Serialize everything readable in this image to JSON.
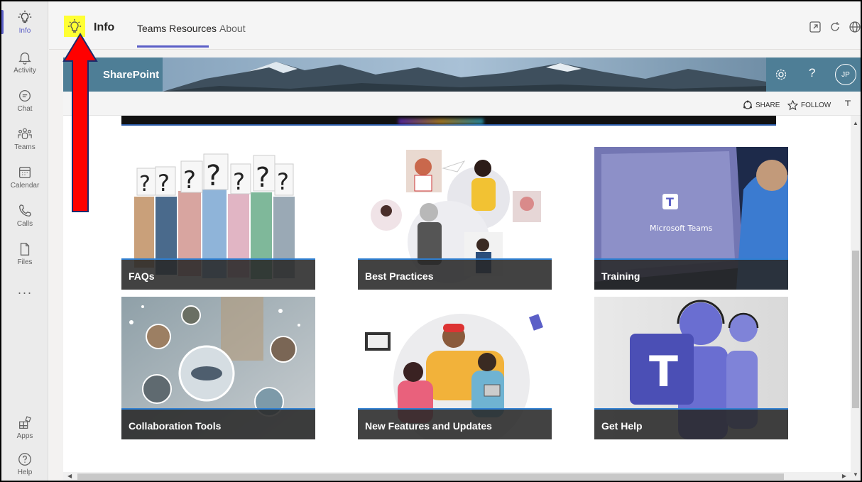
{
  "rail": {
    "items": [
      {
        "label": "Info",
        "icon": "lightbulb-icon"
      },
      {
        "label": "Activity",
        "icon": "bell-icon"
      },
      {
        "label": "Chat",
        "icon": "chat-icon"
      },
      {
        "label": "Teams",
        "icon": "teams-icon"
      },
      {
        "label": "Calendar",
        "icon": "calendar-icon"
      },
      {
        "label": "Calls",
        "icon": "phone-icon"
      },
      {
        "label": "Files",
        "icon": "file-icon"
      }
    ],
    "more": "···",
    "apps": "Apps",
    "help": "Help"
  },
  "header": {
    "app_title": "Info",
    "tabs": [
      {
        "label": "Teams Resources",
        "active": true
      },
      {
        "label": "About",
        "active": false
      }
    ],
    "icons": [
      "popout-icon",
      "refresh-icon",
      "globe-icon"
    ]
  },
  "sharepoint": {
    "title": "SharePoint",
    "avatar": "JP",
    "help": "?",
    "share": "SHARE",
    "follow": "FOLLOW"
  },
  "tiles": [
    {
      "label": "FAQs"
    },
    {
      "label": "Best Practices"
    },
    {
      "label": "Training"
    },
    {
      "label": "Collaboration Tools"
    },
    {
      "label": "New Features and Updates"
    },
    {
      "label": "Get Help"
    }
  ],
  "training_image_text": "Microsoft Teams",
  "colors": {
    "accent": "#5b5fc7",
    "info_icon_bg": "#ffff33",
    "annotation_arrow": "#ff0000"
  }
}
